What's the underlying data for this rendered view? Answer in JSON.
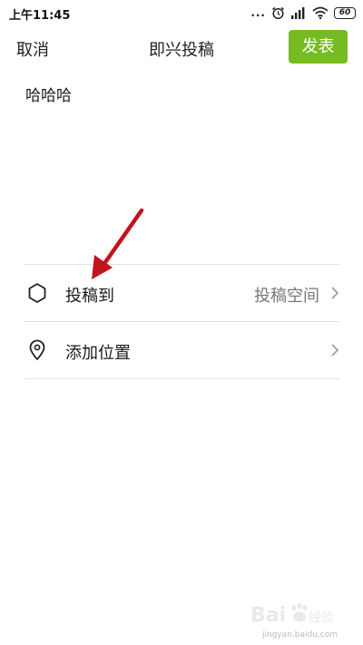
{
  "status_bar": {
    "time": "上午11:45",
    "battery": "60",
    "dots": "..."
  },
  "header": {
    "cancel_label": "取消",
    "title": "即兴投稿",
    "publish_label": "发表"
  },
  "post": {
    "text": "哈哈哈"
  },
  "options": [
    {
      "label": "投稿到",
      "value": "投稿空间",
      "icon": "hexagon-icon"
    },
    {
      "label": "添加位置",
      "value": "",
      "icon": "location-pin-icon"
    }
  ],
  "watermark": {
    "logo_text": "Baidu 经验",
    "url": "jingyan.baidu.com"
  },
  "colors": {
    "accent": "#76bc21",
    "annotation": "#c0141c",
    "divider": "#e2e2e2"
  }
}
